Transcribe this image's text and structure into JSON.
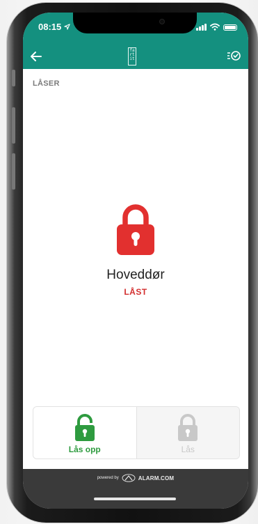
{
  "status_bar": {
    "time": "08:15"
  },
  "header": {
    "logo_text": "fa rt it"
  },
  "section": {
    "label": "LÅSER"
  },
  "device": {
    "name": "Hoveddør",
    "state": "LÅST",
    "state_color": "#d32f2f",
    "lock_color": "#e2302f"
  },
  "actions": {
    "unlock_label": "Lås opp",
    "lock_label": "Lås",
    "unlock_color": "#2e9b3f",
    "disabled_color": "#c8c8c8"
  },
  "footer": {
    "powered_by": "powered by",
    "brand": "ALARM.COM"
  },
  "colors": {
    "primary": "#14907f",
    "footer_bg": "#3a3a3a"
  },
  "icons": [
    "back-arrow-icon",
    "app-logo-icon",
    "scenes-icon",
    "padlock-locked-icon",
    "padlock-unlocked-icon",
    "padlock-icon",
    "alarm-com-logo-icon"
  ]
}
